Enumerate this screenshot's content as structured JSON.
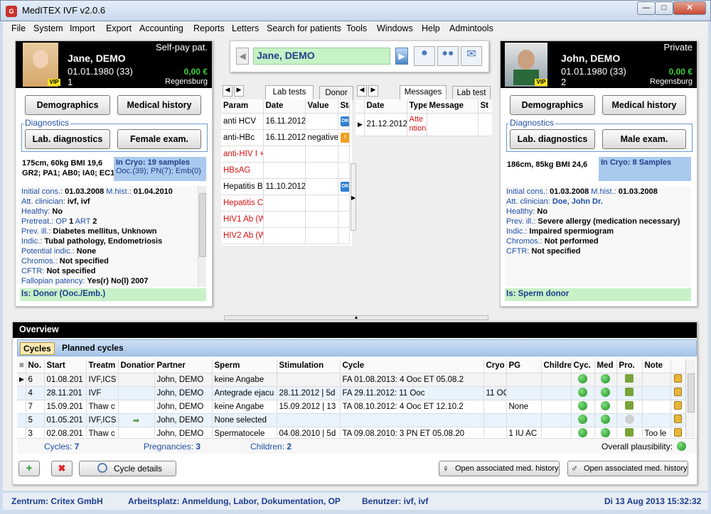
{
  "window": {
    "title": "MedITEX IVF v2.0.6"
  },
  "menu": [
    "File",
    "System",
    "Import",
    "Export",
    "Accounting",
    "Reports",
    "Letters",
    "Search for patients",
    "Tools",
    "Windows",
    "Help",
    "Admintools"
  ],
  "female": {
    "payment": "Self-pay pat.",
    "name": "Jane, DEMO",
    "dob_age": "01.01.1980  (33)",
    "number": "1",
    "balance": "0,00 €",
    "city": "Regensburg",
    "vip": "VIP",
    "buttons": {
      "demographics": "Demographics",
      "medical_history": "Medical history",
      "diagnostics_label": "Diagnostics",
      "lab": "Lab. diagnostics",
      "exam": "Female exam."
    },
    "body": "175cm, 60kg BMI 19,6",
    "gr": "GR2; PA1; AB0; IA0; EC1",
    "cryo": "In Cryo: 19 samples",
    "cryo2": "Ooc.(39); PN(7); Emb(0)",
    "details": [
      [
        "Initial cons.: ",
        "01.03.2008",
        "  M.hist.: ",
        "01.04.2010"
      ],
      [
        "Att. clinician: ",
        "ivf, ivf",
        "",
        ""
      ],
      [
        "Healthy: ",
        "No",
        "",
        ""
      ],
      [
        "Pretreat.: OP ",
        "1",
        "   ART ",
        "2"
      ],
      [
        "Prev. ill.: ",
        "Diabetes mellitus, Unknown",
        "",
        ""
      ],
      [
        "Indic.: ",
        "Tubal pathology, Endometriosis",
        "",
        ""
      ],
      [
        "Potential indic.: ",
        "None",
        "",
        ""
      ],
      [
        "Chromos.: ",
        "Not specified",
        "",
        ""
      ],
      [
        "CFTR: ",
        "Not specified",
        "",
        ""
      ],
      [
        "Fallopian patency: ",
        "Yes(r) No(l) 2007",
        "",
        ""
      ]
    ],
    "is": "Is: Donor (Ooc./Emb.)"
  },
  "male": {
    "payment": "Private",
    "name": "John, DEMO",
    "dob_age": "01.01.1980  (33)",
    "number": "2",
    "balance": "0,00 €",
    "city": "Regensburg",
    "vip": "VIP",
    "buttons": {
      "demographics": "Demographics",
      "medical_history": "Medical history",
      "diagnostics_label": "Diagnostics",
      "lab": "Lab. diagnostics",
      "exam": "Male exam."
    },
    "body": "186cm, 85kg BMI 24,6",
    "cryo": "In Cryo: 8 Samples",
    "details": [
      [
        "Initial cons.: ",
        "01.03.2008",
        "  M.hist.: ",
        "01.03.2008"
      ],
      [
        "Att. clinician: ",
        "Doe, John Dr.",
        "",
        ""
      ],
      [
        "Healthy: ",
        "No",
        "",
        ""
      ],
      [
        "Prev. ill.: ",
        "Severe allergy (medication necessary)",
        "",
        ""
      ],
      [
        "Indic.: ",
        "Impaired spermiogram",
        "",
        ""
      ],
      [
        "Chromos.: ",
        "Not performed",
        "",
        ""
      ],
      [
        "CFTR: ",
        "Not specified",
        "",
        ""
      ]
    ],
    "is": "Is: Sperm donor"
  },
  "search": {
    "current": "Jane, DEMO"
  },
  "labtabs": {
    "left": [
      "Lab tests",
      "Donor"
    ],
    "right": [
      "Messages",
      "Lab test"
    ]
  },
  "labgrid": {
    "headers": [
      "Param",
      "Date",
      "Value",
      "Sta"
    ],
    "rows": [
      {
        "param": "anti HCV",
        "date": "16.11.2012",
        "value": "",
        "status": "OK",
        "red": false
      },
      {
        "param": "anti-HBc",
        "date": "16.11.2012",
        "value": "negative",
        "status": "!",
        "red": false
      },
      {
        "param": "anti-HIV I +",
        "date": "",
        "value": "",
        "status": "",
        "red": true
      },
      {
        "param": "HBsAG",
        "date": "",
        "value": "",
        "status": "",
        "red": true
      },
      {
        "param": "Hepatitis B",
        "date": "11.10.2012",
        "value": "",
        "status": "OK",
        "red": false
      },
      {
        "param": "Hepatitis C",
        "date": "",
        "value": "",
        "status": "",
        "red": true
      },
      {
        "param": "HIV1 Ab (W",
        "date": "",
        "value": "",
        "status": "",
        "red": true
      },
      {
        "param": "HIV2 Ab (W",
        "date": "",
        "value": "",
        "status": "",
        "red": true
      }
    ]
  },
  "msggrid": {
    "headers": [
      "Date",
      "Type",
      "Message",
      "St"
    ],
    "rows": [
      {
        "date": "21.12.2012",
        "type1": "Atte",
        "type2": "ntion"
      }
    ]
  },
  "overview": {
    "title": "Overview",
    "tabs": [
      "Cycles",
      "Planned cycles"
    ],
    "headers": [
      "No.",
      "Start",
      "Treatm",
      "Donation",
      "Partner",
      "Sperm",
      "Stimulation",
      "Cycle",
      "Cryo",
      "PG",
      "Childre",
      "Cyc.",
      "Med",
      "Pro.",
      "Note",
      ""
    ],
    "rows": [
      {
        "no": "6",
        "start": "01.08.201",
        "treat": "IVF,ICS",
        "don": "",
        "partner": "John, DEMO",
        "sperm": "keine Angabe",
        "stim": "",
        "cycle": "FA 01.08.2013: 4 Ooc     ET 05.08.2",
        "cryo": "",
        "pg": "",
        "child": "",
        "cyc": "g",
        "med": "g",
        "pro": "t",
        "note": ""
      },
      {
        "no": "4",
        "start": "28.11.201",
        "treat": "IVF",
        "don": "",
        "partner": "John, DEMO",
        "sperm": "Antegrade ejacu",
        "stim": "28.11.2012 | 5d",
        "cycle": "FA 29.11.2012: 11 Ooc",
        "cryo": "11 OC",
        "pg": "",
        "child": "",
        "cyc": "g",
        "med": "g",
        "pro": "t",
        "note": ""
      },
      {
        "no": "7",
        "start": "15.09.201",
        "treat": "Thaw c",
        "don": "",
        "partner": "John, DEMO",
        "sperm": "keine Angabe",
        "stim": "15.09.2012 | 13",
        "cycle": "TA 08.10.2012: 4 Ooc     ET 12.10.2",
        "cryo": "",
        "pg": "None",
        "child": "",
        "cyc": "g",
        "med": "g",
        "pro": "t",
        "note": ""
      },
      {
        "no": "5",
        "start": "01.05.201",
        "treat": "IVF,ICS",
        "don": "arrow",
        "partner": "John, DEMO",
        "sperm": "None selected",
        "stim": "",
        "cycle": "",
        "cryo": "",
        "pg": "",
        "child": "",
        "cyc": "g",
        "med": "g",
        "pro": "x",
        "note": ""
      },
      {
        "no": "3",
        "start": "02.08.201",
        "treat": "Thaw c",
        "don": "",
        "partner": "John, DEMO",
        "sperm": "Spermatocele",
        "stim": "04.08.2010 | 5d",
        "cycle": "TA 09.08.2010: 3 PN     ET 05.08.20",
        "cryo": "",
        "pg": "1 IU AC",
        "child": "",
        "cyc": "g",
        "med": "g",
        "pro": "t",
        "note": "Too le"
      }
    ],
    "footer": {
      "cycles_label": "Cycles:",
      "cycles": "7",
      "preg_label": "Pregnancies:",
      "preg": "3",
      "children_label": "Children:",
      "children": "2",
      "plaus": "Overall plausibility:"
    },
    "cycle_details": "Cycle details",
    "open_female": "Open associated med. history",
    "open_male": "Open associated med. history"
  },
  "status": {
    "zentrum": "Zentrum: Critex GmbH",
    "arbeitsplatz": "Arbeitsplatz: Anmeldung, Labor, Dokumentation, OP",
    "benutzer": "Benutzer: ivf, ivf",
    "datetime": "Di 13 Aug 2013 15:32:32"
  }
}
